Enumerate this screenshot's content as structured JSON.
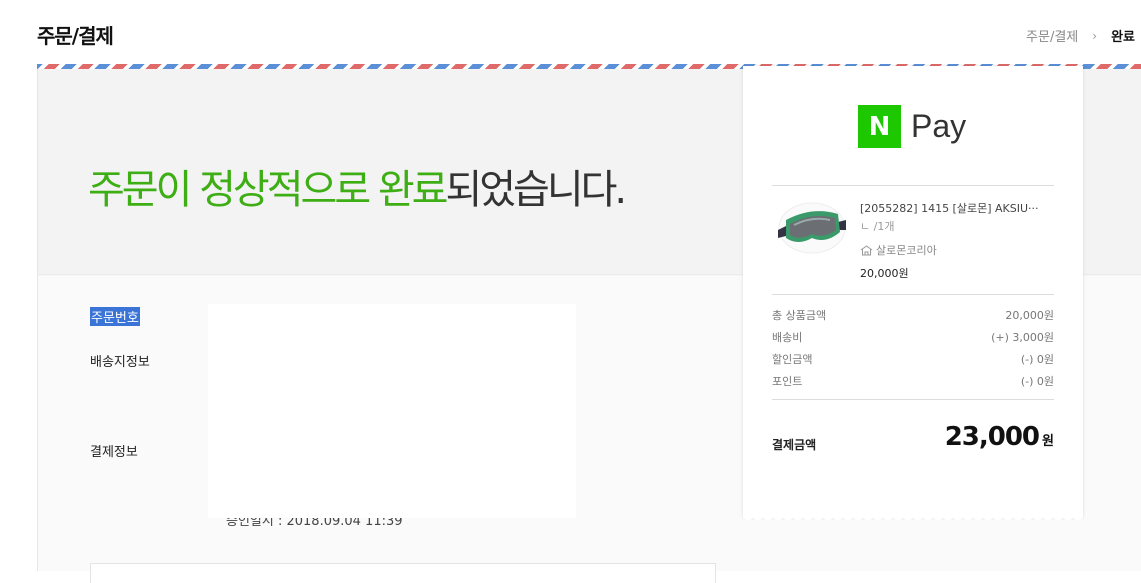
{
  "header": {
    "title": "주문/결제",
    "breadcrumb": [
      "주문/결제",
      "완료"
    ]
  },
  "hero": {
    "message_green": "주문이 정상적으로 완료",
    "message_rest": "되었습니다."
  },
  "info": {
    "order_number_label": "주문번호",
    "shipping_label": "배송지정보",
    "payment_label": "결제정보",
    "approval_text": "승인일시 : 2018.09.04 11:39"
  },
  "receipt": {
    "brand_letter": "N",
    "brand_text": "Pay",
    "item": {
      "name": "[2055282] 1415 [살로몬] AKSIU···",
      "qty": "ㄴ /1개",
      "seller": "살로몬코리아",
      "price": "20,000원"
    },
    "summary": [
      {
        "label": "총 상품금액",
        "value": "20,000원"
      },
      {
        "label": "배송비",
        "value": "(+) 3,000원"
      },
      {
        "label": "할인금액",
        "value": "(-) 0원"
      },
      {
        "label": "포인트",
        "value": "(-) 0원"
      }
    ],
    "total_label": "결제금액",
    "total_value": "23,000",
    "total_unit": "원"
  },
  "colors": {
    "accent_green": "#3dae14",
    "naver_green": "#1ec800"
  }
}
